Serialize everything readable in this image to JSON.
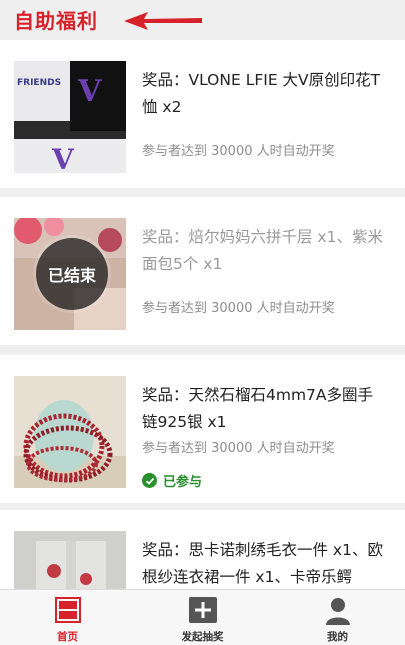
{
  "header": {
    "title": "自助福利"
  },
  "cards": [
    {
      "title": "奖品：VLONE LFIE 大V原创印花T恤 x2",
      "condition": "参与者达到 30000 人时自动开奖",
      "status": ""
    },
    {
      "title": "奖品：焙尔妈妈六拼千层 x1、紫米面包5个 x1",
      "condition": "参与者达到 30000 人时自动开奖",
      "status": "ended",
      "badge": "已结束"
    },
    {
      "title": "奖品：天然石榴石4mm7A多圈手链925银 x1",
      "condition": "参与者达到 30000 人时自动开奖",
      "status": "joined",
      "joined_label": "已参与"
    },
    {
      "title": "奖品：思卡诺刺绣毛衣一件 x1、欧根纱连衣裙一件 x1、卡帝乐鳄",
      "condition": "",
      "status": ""
    }
  ],
  "tabbar": {
    "items": [
      {
        "label": "首页",
        "icon": "home-icon",
        "active": true
      },
      {
        "label": "发起抽奖",
        "icon": "plus-icon",
        "active": false
      },
      {
        "label": "我的",
        "icon": "user-icon",
        "active": false
      }
    ]
  },
  "colors": {
    "brand_red": "#d8222b",
    "joined_green": "#2a8f2d"
  }
}
